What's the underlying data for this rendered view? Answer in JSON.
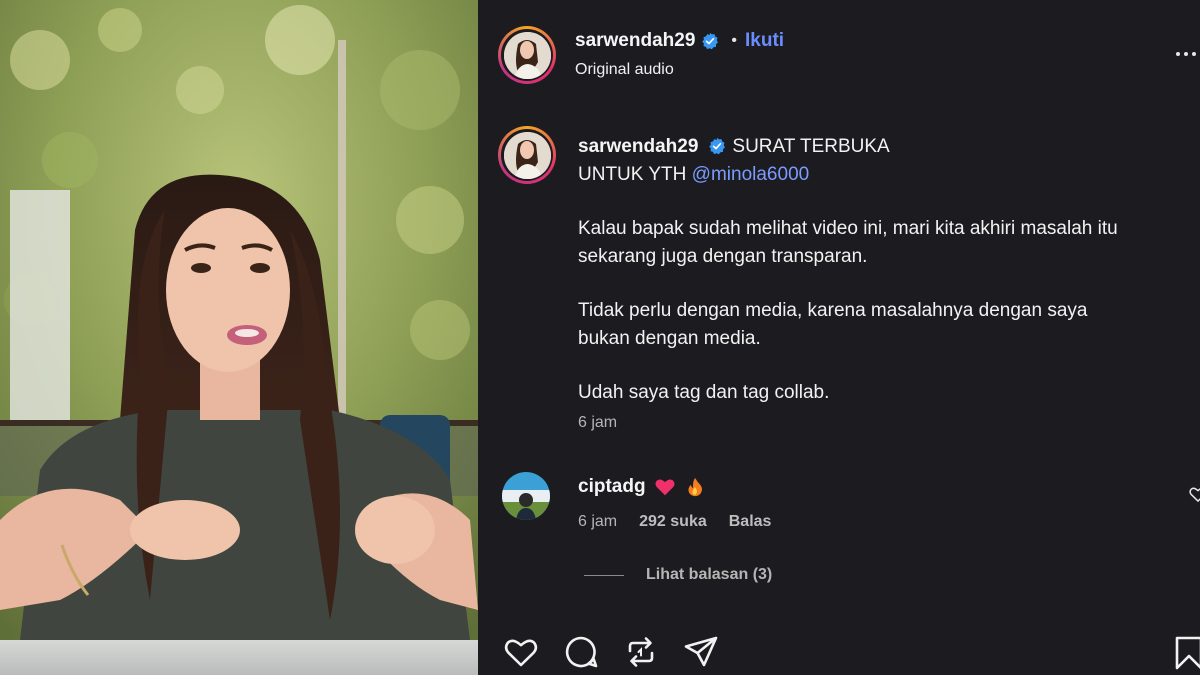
{
  "media": {
    "description_icon": "video-frame"
  },
  "header": {
    "username": "sarwendah29",
    "separator": "•",
    "follow_label": "Ikuti",
    "audio_label": "Original audio"
  },
  "caption": {
    "username": "sarwendah29",
    "headline": "SURAT TERBUKA",
    "line2_prefix": "UNTUK YTH",
    "mention": "@minola6000",
    "paragraph1": "Kalau bapak sudah melihat video ini, mari kita akhiri masalah itu sekarang juga dengan transparan.",
    "paragraph2": "Tidak perlu dengan media, karena masalahnya dengan saya bukan dengan media.",
    "paragraph3": "Udah saya tag dan tag collab.",
    "time": "6 jam"
  },
  "comment": {
    "username": "ciptadg",
    "time": "6 jam",
    "likes": "292 suka",
    "reply_label": "Balas",
    "view_replies": "Lihat balasan (3)"
  },
  "actions": {
    "icons": [
      "heart-icon",
      "comment-icon",
      "repost-icon",
      "share-icon",
      "bookmark-icon"
    ]
  },
  "colors": {
    "background": "#1c1c20",
    "link": "#6b8cff",
    "verified": "#3897f0"
  }
}
